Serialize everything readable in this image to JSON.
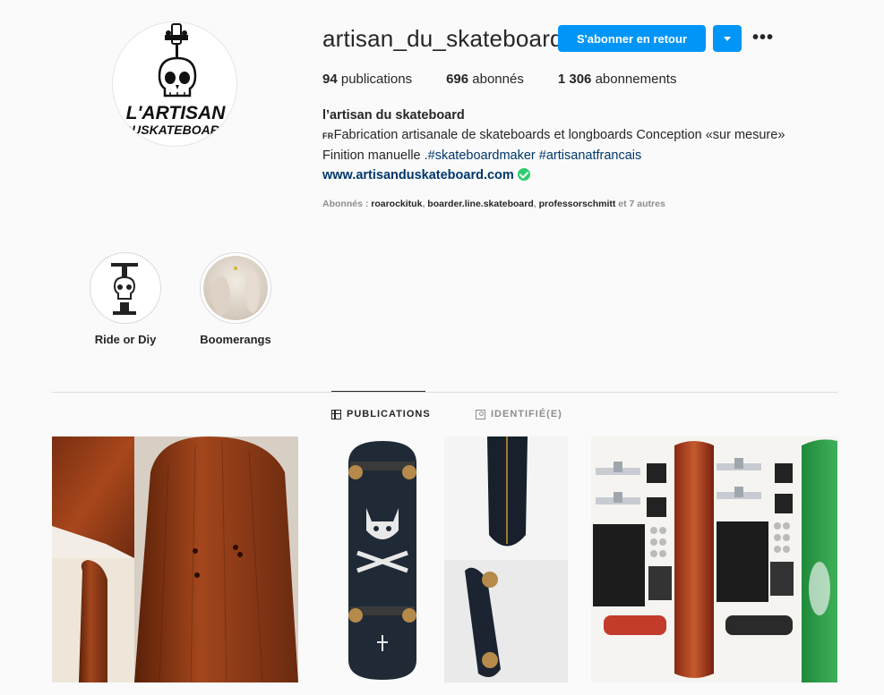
{
  "profile": {
    "username": "artisan_du_skateboard",
    "follow_button": "S'abonner en retour",
    "more_icon": "more-horizontal-icon",
    "stats": {
      "posts_count": "94",
      "posts_label": "publications",
      "followers_count": "696",
      "followers_label": "abonnés",
      "following_count": "1 306",
      "following_label": "abonnements"
    },
    "bio": {
      "name": "l’artisan du skateboard",
      "flag": "FR",
      "line1": "Fabrication artisanale de skateboards et longboards Conception «sur mesure»",
      "line2_prefix": "Finition manuelle .",
      "hashtag1": "#skateboardmaker",
      "hashtag2": "#artisanatfrancais",
      "website": "www.artisanduskateboard.com"
    },
    "followed_by": {
      "prefix": "Abonnés : ",
      "user1": "roarockituk",
      "user2": "boarder.line.skateboard",
      "user3": "professorschmitt",
      "suffix": " et 7 autres"
    },
    "logo_text": {
      "line1": "L'ARTISAN",
      "line2": "DUSKATEBOARD"
    }
  },
  "highlights": [
    {
      "label": "Ride or Diy"
    },
    {
      "label": "Boomerangs"
    }
  ],
  "tabs": [
    {
      "label": "PUBLICATIONS",
      "icon": "grid-icon",
      "active": true
    },
    {
      "label": "IDENTIFIÉ(E)",
      "icon": "tagged-icon",
      "active": false
    }
  ],
  "colors": {
    "accent": "#0095f6",
    "link": "#00376b",
    "verified": "#2ecc71"
  }
}
